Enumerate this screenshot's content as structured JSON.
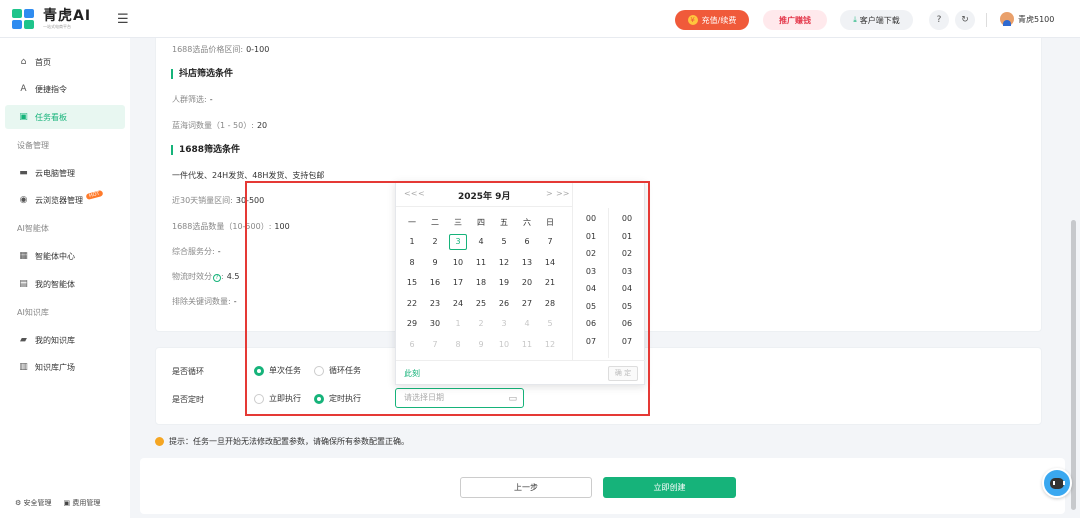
{
  "header": {
    "logo_title": "青虎AI",
    "logo_sub": "一站式电商平台",
    "recharge": "充值/续费",
    "promo": "推广赚钱",
    "download": "客户端下载",
    "username": "青虎5100"
  },
  "sidebar": {
    "items": [
      {
        "label": "首页",
        "icon": "home-icon"
      },
      {
        "label": "便捷指令",
        "icon": "ai-command-icon"
      },
      {
        "label": "任务看板",
        "icon": "task-board-icon",
        "active": true
      }
    ],
    "section_device": "设备管理",
    "device_items": [
      {
        "label": "云电脑管理",
        "icon": "monitor-icon"
      },
      {
        "label": "云浏览器管理",
        "icon": "browser-icon",
        "badge": "HOT"
      }
    ],
    "section_agent": "AI智能体",
    "agent_items": [
      {
        "label": "智能体中心",
        "icon": "grid-icon"
      },
      {
        "label": "我的智能体",
        "icon": "agent-icon"
      }
    ],
    "section_kb": "AI知识库",
    "kb_items": [
      {
        "label": "我的知识库",
        "icon": "folder-icon"
      },
      {
        "label": "知识库广场",
        "icon": "book-icon"
      }
    ],
    "bottom_security": "安全管理",
    "bottom_billing": "费用管理"
  },
  "config": {
    "price_range_label": "1688选品价格区间:",
    "price_range_value": "0-100",
    "douyin_title": "抖店筛选条件",
    "crowd_label": "人群筛选:",
    "crowd_value": "-",
    "blue_label": "蓝海词数量（1 - 50）:",
    "blue_value": "20",
    "ali_title": "1688筛选条件",
    "ali_features": "一件代发、24H发货、48H发货、支持包邮",
    "sales_label": "近30天销量区间:",
    "sales_value": "30-500",
    "count_label": "1688选品数量（10-500）:",
    "count_value": "100",
    "service_label": "综合服务分:",
    "service_value": "-",
    "logistics_label": "物流时效分",
    "logistics_value": "4.5",
    "exclude_label": "排除关键词数量:",
    "exclude_value": "-"
  },
  "options": {
    "loop_label": "是否循环",
    "loop_single": "单次任务",
    "loop_cycle": "循环任务",
    "timer_label": "是否定时",
    "timer_now": "立即执行",
    "timer_scheduled": "定时执行",
    "date_placeholder": "请选择日期"
  },
  "tip": "提示：任务一旦开始无法修改配置参数，请确保所有参数配置正确。",
  "buttons": {
    "prev": "上一步",
    "create": "立即创建"
  },
  "picker": {
    "nav_prev_year": "<<",
    "nav_prev_month": "<",
    "nav_next_month": ">",
    "nav_next_year": ">>",
    "title": "2025年 9月",
    "weekdays": [
      "一",
      "二",
      "三",
      "四",
      "五",
      "六",
      "日"
    ],
    "days": [
      [
        "1",
        "2",
        "3",
        "4",
        "5",
        "6",
        "7"
      ],
      [
        "8",
        "9",
        "10",
        "11",
        "12",
        "13",
        "14"
      ],
      [
        "15",
        "16",
        "17",
        "18",
        "19",
        "20",
        "21"
      ],
      [
        "22",
        "23",
        "24",
        "25",
        "26",
        "27",
        "28"
      ],
      [
        "29",
        "30",
        "1",
        "2",
        "3",
        "4",
        "5"
      ],
      [
        "6",
        "7",
        "8",
        "9",
        "10",
        "11",
        "12"
      ]
    ],
    "selected_day": "3",
    "hours": [
      "00",
      "01",
      "02",
      "03",
      "04",
      "05",
      "06",
      "07"
    ],
    "minutes": [
      "00",
      "01",
      "02",
      "03",
      "04",
      "05",
      "06",
      "07"
    ],
    "now": "此刻",
    "ok": "确 定"
  },
  "colors": {
    "accent": "#16b37a",
    "highlight": "#e53935"
  }
}
